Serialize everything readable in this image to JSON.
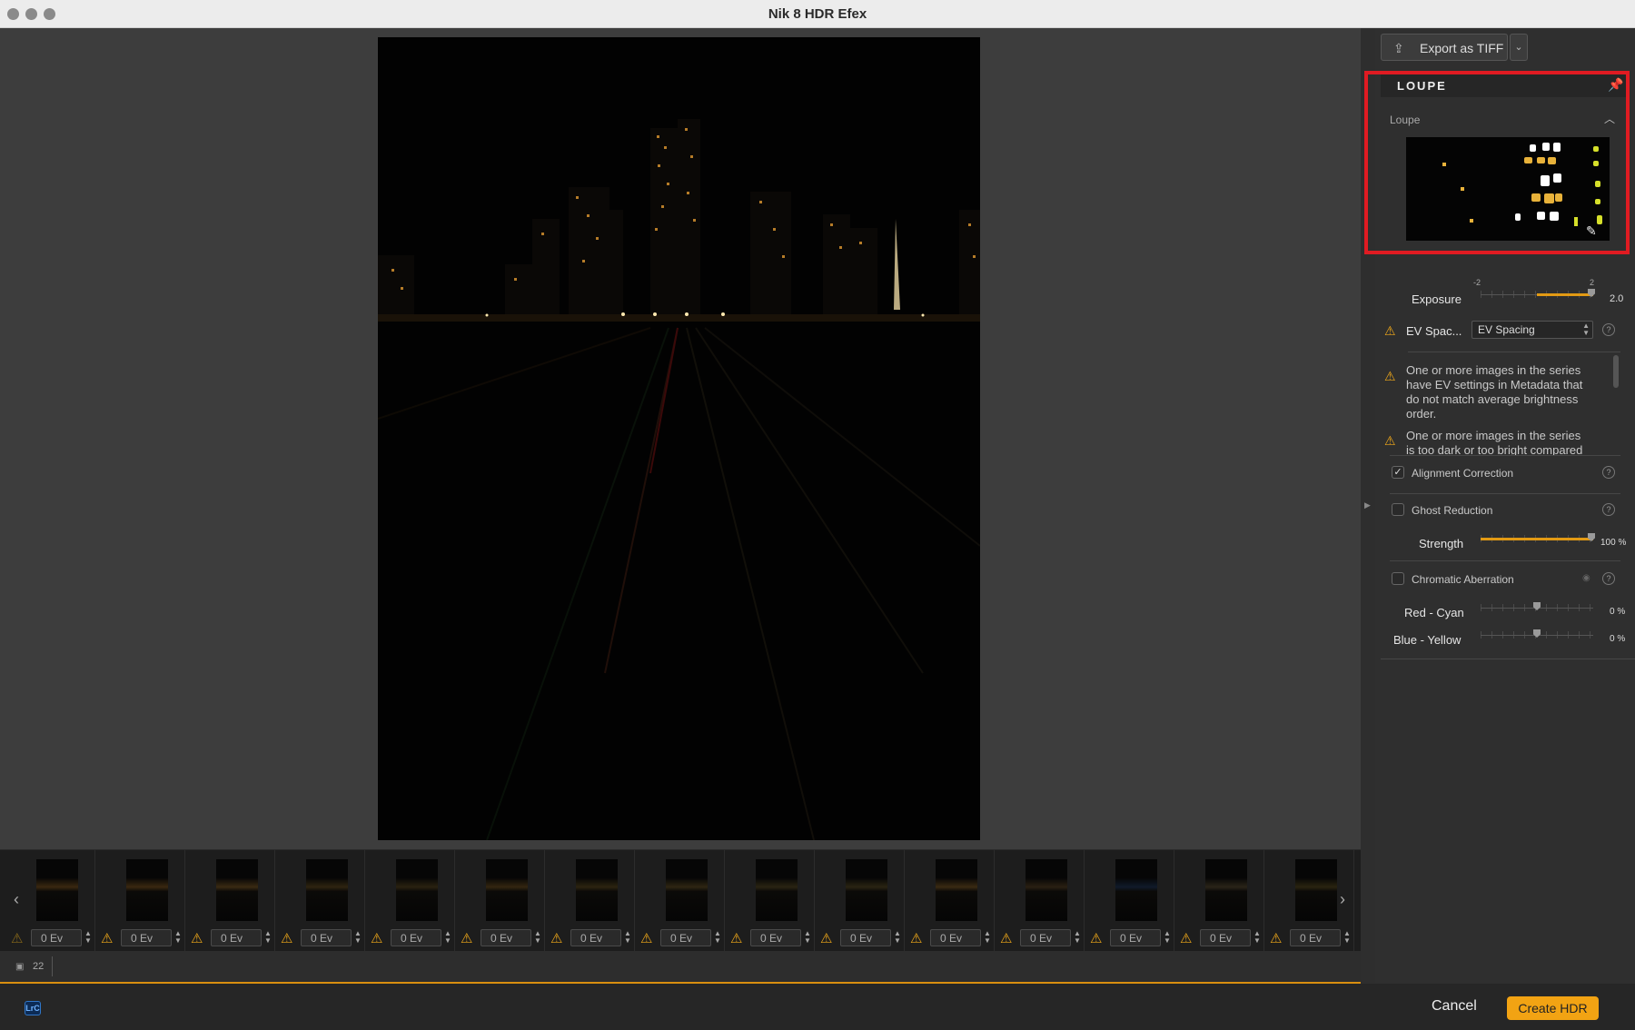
{
  "window": {
    "title": "Nik 8 HDR Efex"
  },
  "toolbar": {
    "export_label": "Export as TIFF"
  },
  "loupe": {
    "header": "LOUPE",
    "sublabel": "Loupe"
  },
  "exposure": {
    "label": "Exposure",
    "min_label": "-2",
    "max_label": "2",
    "value": "2.0",
    "level": 1.0
  },
  "ev_spacing": {
    "label": "EV Spac...",
    "selected": "EV Spacing",
    "messages": [
      "One or more images in the series have EV settings in Metadata that do not match average brightness order.",
      "One or more images in the series is too dark or too bright compared to"
    ]
  },
  "alignment": {
    "label": "Alignment Correction",
    "checked": true
  },
  "ghost": {
    "label": "Ghost Reduction",
    "checked": false,
    "strength_label": "Strength",
    "strength_value": "100 %",
    "strength_level": 1.0
  },
  "chromatic": {
    "label": "Chromatic Aberration",
    "checked": false,
    "red_cyan_label": "Red - Cyan",
    "red_cyan_value": "0 %",
    "blue_yellow_label": "Blue - Yellow",
    "blue_yellow_value": "0 %"
  },
  "filmstrip": {
    "ev_values": [
      "0 Ev",
      "0 Ev",
      "0 Ev",
      "0 Ev",
      "0 Ev",
      "0 Ev",
      "0 Ev",
      "0 Ev",
      "0 Ev",
      "0 Ev",
      "0 Ev",
      "0 Ev",
      "0 Ev",
      "0 Ev",
      "0 Ev"
    ],
    "image_count": "22"
  },
  "footer": {
    "lrc_label": "LrC",
    "cancel_label": "Cancel",
    "create_label": "Create HDR"
  },
  "colors": {
    "accent": "#f2a313",
    "highlight": "#e01b22",
    "warning": "#f0a91a"
  },
  "icons": [
    "share-icon",
    "chevron-down-icon",
    "pin-icon",
    "chevron-up-icon",
    "warning-icon",
    "help-icon",
    "checkmark-icon",
    "eye-icon",
    "chevron-left-icon",
    "chevron-right-icon",
    "image-stack-icon"
  ]
}
